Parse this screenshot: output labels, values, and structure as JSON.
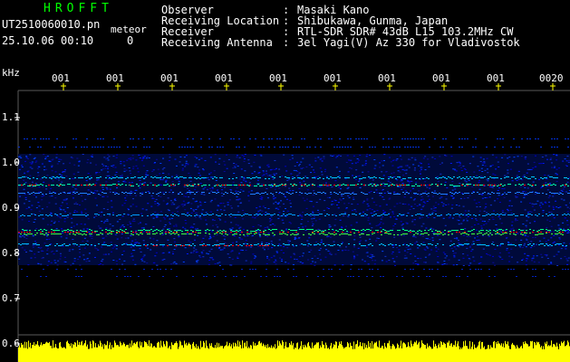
{
  "header": {
    "program": "HROFFT",
    "filename": "UT2510060010.pn",
    "tag": "meteor",
    "datetime": "25.10.06 00:10",
    "count": "0"
  },
  "info": [
    {
      "label": "Observer",
      "value": "Masaki Kano"
    },
    {
      "label": "Receiving Location",
      "value": "Shibukawa, Gunma, Japan"
    },
    {
      "label": "Receiver",
      "value": "RTL-SDR SDR# 43dB L15 103.2MHz CW"
    },
    {
      "label": "Receiving Antenna",
      "value": "3el Yagi(V) Az 330 for Vladivostok"
    }
  ],
  "axis": {
    "y_unit": "kHz",
    "y_labels": [
      "1.1",
      "1.0",
      "0.9",
      "0.8",
      "0.7",
      "0.6"
    ],
    "x_labels": [
      "001",
      "001",
      "001",
      "001",
      "001",
      "001",
      "001",
      "001",
      "001",
      "0020"
    ]
  },
  "colors": {
    "background": "#000000",
    "text": "#ffffff",
    "title": "#00ff00",
    "meteor_tag": "#ffffff",
    "tick": "#ffff00",
    "signal_low": "#0000ff",
    "signal_high": "#ff0000",
    "amplitude_bar": "#ffff00"
  }
}
